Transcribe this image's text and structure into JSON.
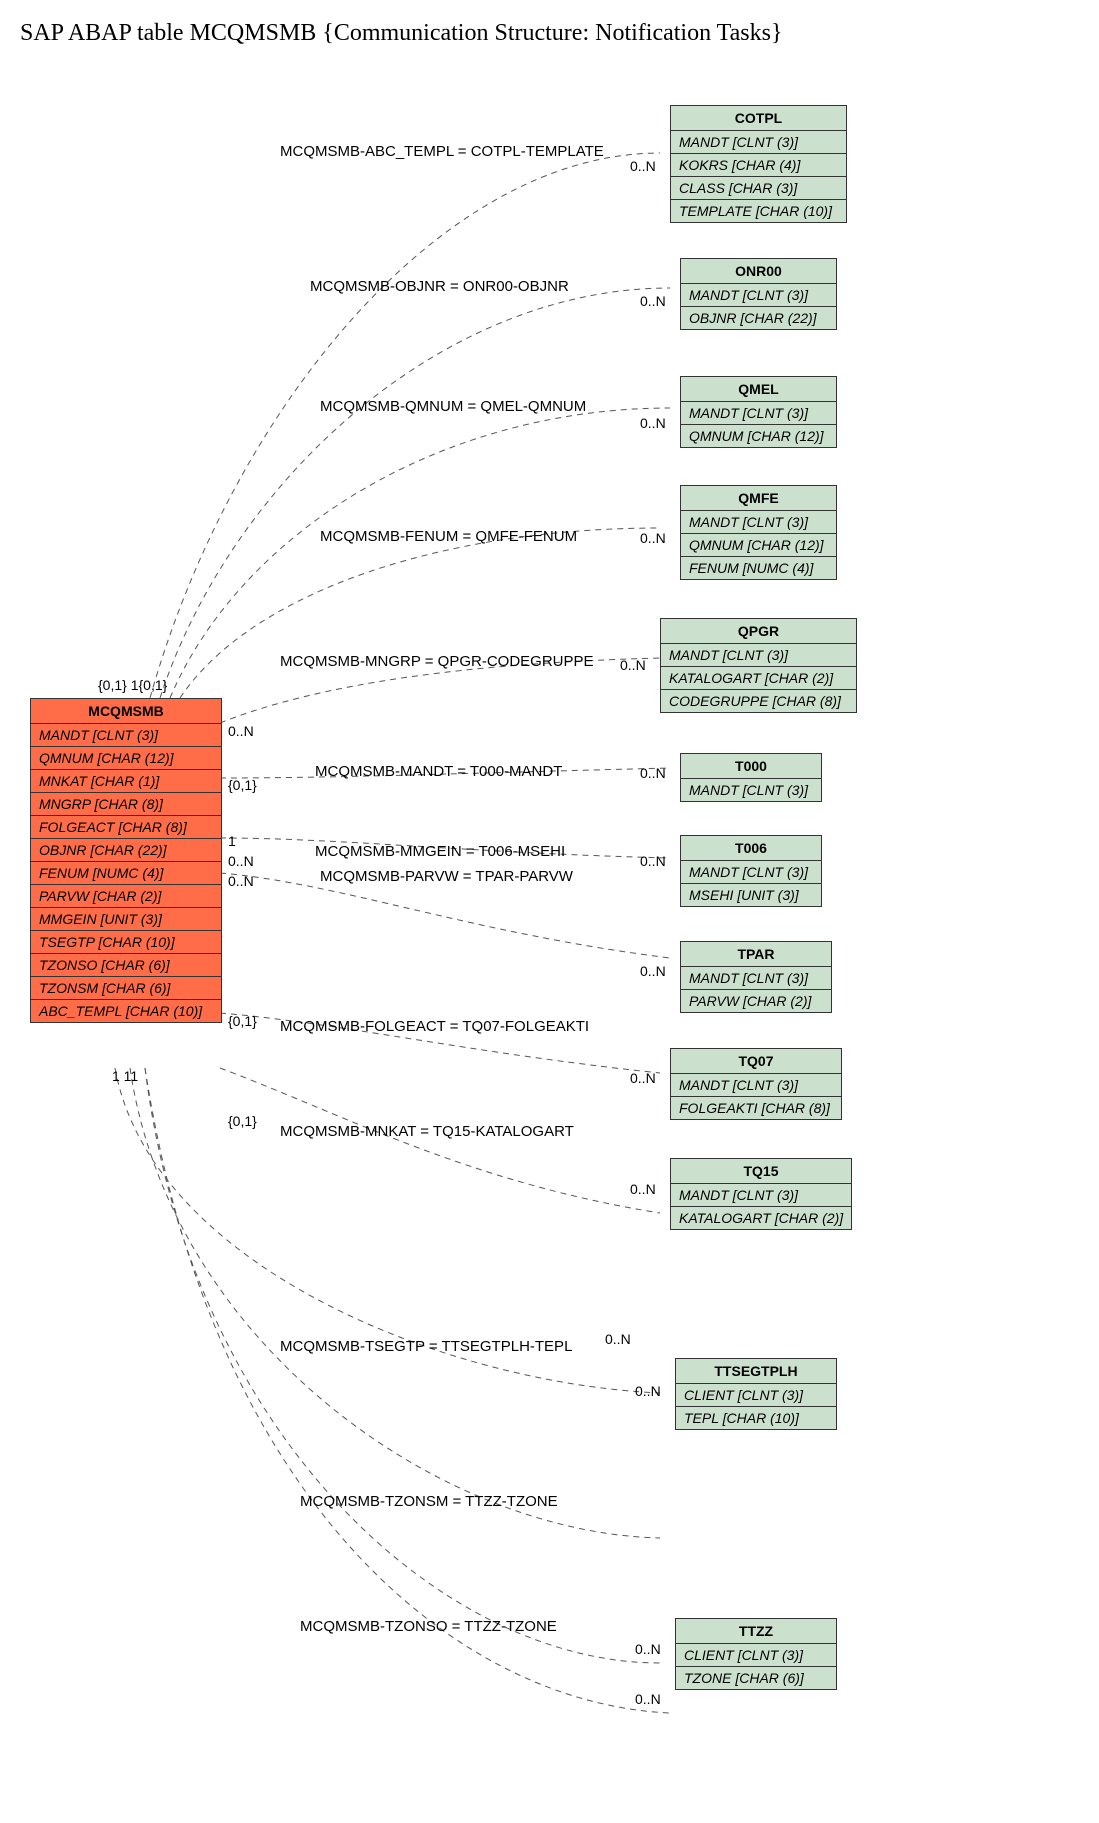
{
  "title": "SAP ABAP table MCQMSMB {Communication Structure: Notification Tasks}",
  "main": {
    "name": "MCQMSMB",
    "fields": [
      "MANDT [CLNT (3)]",
      "QMNUM [CHAR (12)]",
      "MNKAT [CHAR (1)]",
      "MNGRP [CHAR (8)]",
      "FOLGEACT [CHAR (8)]",
      "OBJNR [CHAR (22)]",
      "FENUM [NUMC (4)]",
      "PARVW [CHAR (2)]",
      "MMGEIN [UNIT (3)]",
      "TSEGTP [CHAR (10)]",
      "TZONSO [CHAR (6)]",
      "TZONSM [CHAR (6)]",
      "ABC_TEMPL [CHAR (10)]"
    ]
  },
  "refs": [
    {
      "name": "COTPL",
      "fields": [
        "MANDT [CLNT (3)]",
        "KOKRS [CHAR (4)]",
        "CLASS [CHAR (3)]",
        "TEMPLATE [CHAR (10)]"
      ]
    },
    {
      "name": "ONR00",
      "fields": [
        "MANDT [CLNT (3)]",
        "OBJNR [CHAR (22)]"
      ]
    },
    {
      "name": "QMEL",
      "fields": [
        "MANDT [CLNT (3)]",
        "QMNUM [CHAR (12)]"
      ]
    },
    {
      "name": "QMFE",
      "fields": [
        "MANDT [CLNT (3)]",
        "QMNUM [CHAR (12)]",
        "FENUM [NUMC (4)]"
      ]
    },
    {
      "name": "QPGR",
      "fields": [
        "MANDT [CLNT (3)]",
        "KATALOGART [CHAR (2)]",
        "CODEGRUPPE [CHAR (8)]"
      ]
    },
    {
      "name": "T000",
      "fields": [
        "MANDT [CLNT (3)]"
      ]
    },
    {
      "name": "T006",
      "fields": [
        "MANDT [CLNT (3)]",
        "MSEHI [UNIT (3)]"
      ]
    },
    {
      "name": "TPAR",
      "fields": [
        "MANDT [CLNT (3)]",
        "PARVW [CHAR (2)]"
      ]
    },
    {
      "name": "TQ07",
      "fields": [
        "MANDT [CLNT (3)]",
        "FOLGEAKTI [CHAR (8)]"
      ]
    },
    {
      "name": "TQ15",
      "fields": [
        "MANDT [CLNT (3)]",
        "KATALOGART [CHAR (2)]"
      ]
    },
    {
      "name": "TTSEGTPLH",
      "fields": [
        "CLIENT [CLNT (3)]",
        "TEPL [CHAR (10)]"
      ]
    },
    {
      "name": "TTZZ",
      "fields": [
        "CLIENT [CLNT (3)]",
        "TZONE [CHAR (6)]"
      ]
    }
  ],
  "labels": [
    "MCQMSMB-ABC_TEMPL = COTPL-TEMPLATE",
    "MCQMSMB-OBJNR = ONR00-OBJNR",
    "MCQMSMB-QMNUM = QMEL-QMNUM",
    "MCQMSMB-FENUM = QMFE-FENUM",
    "MCQMSMB-MNGRP = QPGR-CODEGRUPPE",
    "MCQMSMB-MANDT = T000-MANDT",
    "MCQMSMB-MMGEIN = T006-MSEHI",
    "MCQMSMB-PARVW = TPAR-PARVW",
    "MCQMSMB-FOLGEACT = TQ07-FOLGEAKTI",
    "MCQMSMB-MNKAT = TQ15-KATALOGART",
    "MCQMSMB-TSEGTP = TTSEGTPLH-TEPL",
    "MCQMSMB-TZONSM = TTZZ-TZONE",
    "MCQMSMB-TZONSO = TTZZ-TZONE"
  ],
  "cards": {
    "zn": "0..N",
    "z1": "{0,1}",
    "z1b": "{0,1} 1{0,1}",
    "one": "1",
    "oneone": "1 11"
  }
}
